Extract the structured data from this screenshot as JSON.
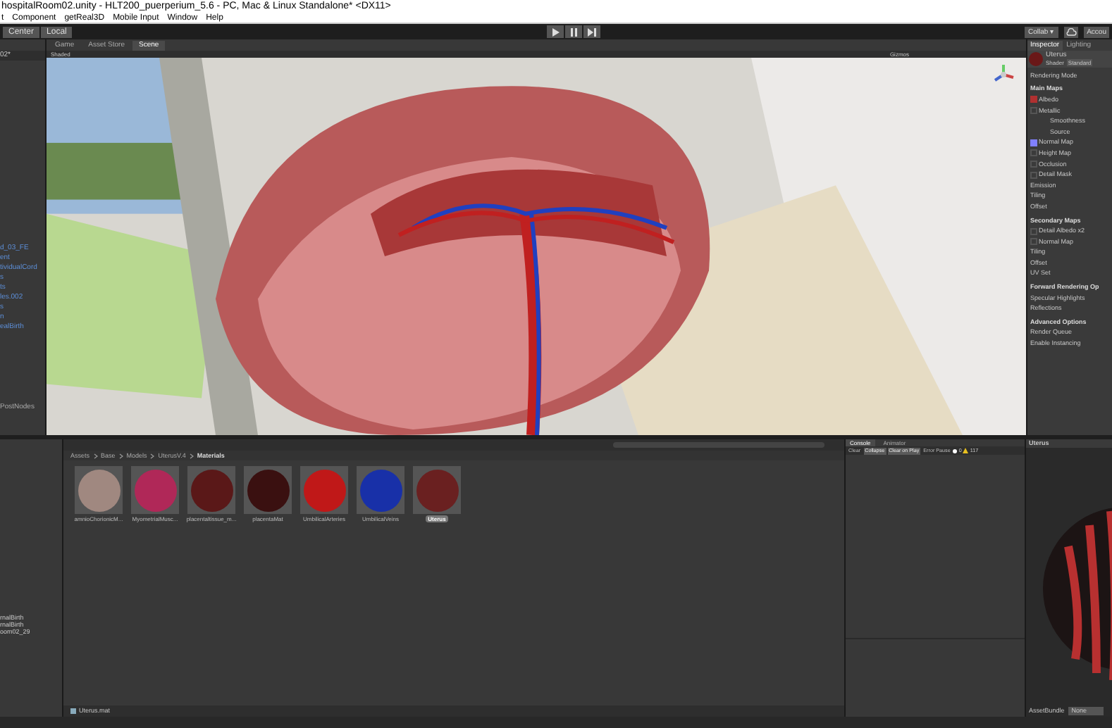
{
  "window": {
    "title": "hospitalRoom02.unity - HLT200_puerperium_5.6 - PC, Mac & Linux Standalone* <DX11>"
  },
  "menu": [
    "t",
    "Component",
    "getReal3D",
    "Mobile Input",
    "Window",
    "Help"
  ],
  "toolbar": {
    "left": [
      "Center",
      "Local"
    ],
    "right": [
      "Collab ▾",
      "Accou"
    ]
  },
  "view_tabs": [
    {
      "label": "Game",
      "selected": false
    },
    {
      "label": "Asset Store",
      "selected": false
    },
    {
      "label": "Scene",
      "selected": true
    }
  ],
  "scene_bar": {
    "mode": "Shaded",
    "gizmos": "Gizmos"
  },
  "hierarchy": {
    "header": "02*",
    "items": [
      "d_03_FE",
      "ent",
      "tividualCord",
      "s",
      "ts",
      "les.002",
      "s",
      "n",
      "ealBirth",
      "PostNodes"
    ]
  },
  "inspector": {
    "tabs": [
      {
        "label": "Inspector",
        "selected": true
      },
      {
        "label": "Lighting",
        "selected": false
      }
    ],
    "object": "Uterus",
    "shader_label": "Shader",
    "shader": "Standard",
    "rows": [
      {
        "kind": "label",
        "text": "Rendering Mode"
      },
      {
        "kind": "header",
        "text": "Main Maps"
      },
      {
        "kind": "map",
        "text": "Albedo",
        "color": "#b03030"
      },
      {
        "kind": "map",
        "text": "Metallic"
      },
      {
        "kind": "sub",
        "text": "Smoothness"
      },
      {
        "kind": "sub",
        "text": "Source"
      },
      {
        "kind": "map",
        "text": "Normal Map",
        "color": "#8080ff"
      },
      {
        "kind": "map",
        "text": "Height Map"
      },
      {
        "kind": "map",
        "text": "Occlusion"
      },
      {
        "kind": "map",
        "text": "Detail Mask"
      },
      {
        "kind": "label",
        "text": "Emission"
      },
      {
        "kind": "label",
        "text": "Tiling"
      },
      {
        "kind": "label",
        "text": "Offset"
      },
      {
        "kind": "header",
        "text": "Secondary Maps"
      },
      {
        "kind": "map",
        "text": "Detail Albedo x2"
      },
      {
        "kind": "map",
        "text": "Normal Map"
      },
      {
        "kind": "label",
        "text": "Tiling"
      },
      {
        "kind": "label",
        "text": "Offset"
      },
      {
        "kind": "label",
        "text": "UV Set"
      },
      {
        "kind": "header",
        "text": "Forward Rendering Op"
      },
      {
        "kind": "label",
        "text": "Specular Highlights"
      },
      {
        "kind": "label",
        "text": "Reflections"
      },
      {
        "kind": "header",
        "text": "Advanced Options"
      },
      {
        "kind": "label",
        "text": "Render Queue"
      },
      {
        "kind": "label",
        "text": "Enable Instancing"
      }
    ],
    "preview_title": "Uterus",
    "assetbundle_label": "AssetBundle",
    "assetbundle": "None"
  },
  "project": {
    "tree": [
      "rnalBirth",
      "rnalBirth",
      "oom02_29"
    ],
    "breadcrumb": [
      "Assets",
      "Base",
      "Models",
      "UterusV.4",
      "Materials"
    ],
    "assets": [
      {
        "name": "amnioChorionicM...",
        "color": "#a08880",
        "selected": false
      },
      {
        "name": "MyometrialMusc...",
        "color": "#b02858",
        "selected": false
      },
      {
        "name": "placentaltissue_m...",
        "color": "#5a1818",
        "selected": false
      },
      {
        "name": "placentaMat",
        "color": "#3a1010",
        "selected": false
      },
      {
        "name": "UmbilicalArteries",
        "color": "#c01818",
        "selected": false
      },
      {
        "name": "UmbilicalVeins",
        "color": "#1830a8",
        "selected": false
      },
      {
        "name": "Uterus",
        "color": "#6a2020",
        "selected": true
      }
    ],
    "footer": "Uterus.mat"
  },
  "console": {
    "tabs": [
      {
        "label": "Console",
        "selected": true
      },
      {
        "label": "Animator",
        "selected": false
      }
    ],
    "buttons": [
      {
        "label": "Clear",
        "on": false
      },
      {
        "label": "Collapse",
        "on": true
      },
      {
        "label": "Clear on Play",
        "on": true
      },
      {
        "label": "Error Pause",
        "on": false
      }
    ],
    "info_count": "0",
    "warning_count": "117"
  }
}
